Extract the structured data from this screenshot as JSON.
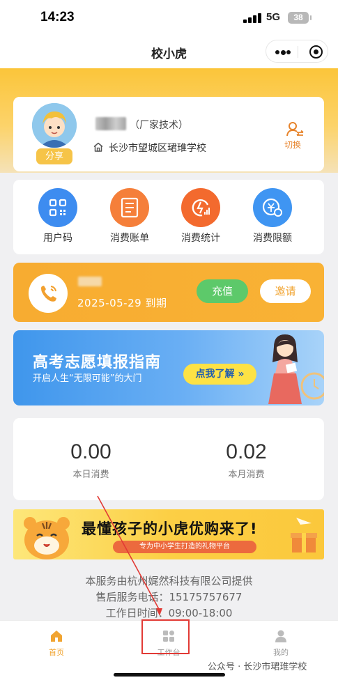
{
  "status_bar": {
    "time": "14:23",
    "network": "5G",
    "battery": "38"
  },
  "nav": {
    "title": "校小虎"
  },
  "profile": {
    "role": "（厂家技术）",
    "school": "长沙市望城区珺琟学校",
    "share_label": "分享",
    "switch_label": "切换"
  },
  "quick_actions": [
    {
      "label": "用户码",
      "icon": "qr-code-icon",
      "color": "#3d8cf0"
    },
    {
      "label": "消费账单",
      "icon": "bill-icon",
      "color": "#f57f3a"
    },
    {
      "label": "消费统计",
      "icon": "statistics-icon",
      "color": "#f36a2e"
    },
    {
      "label": "消费限额",
      "icon": "limit-icon",
      "color": "#3f95f2"
    }
  ],
  "membership": {
    "expire_text": "2025-05-29 到期",
    "recharge_label": "充值",
    "invite_label": "邀请"
  },
  "banner": {
    "title": "高考志愿填报指南",
    "subtitle": "开启人生“无限可能”的大门",
    "button": "点我了解 »"
  },
  "stats": [
    {
      "value": "0.00",
      "label": "本日消费"
    },
    {
      "value": "0.02",
      "label": "本月消费"
    }
  ],
  "shop_banner": {
    "title": "最懂孩子的小虎优购来了!",
    "subtitle": "专为中小学生打造的礼物平台"
  },
  "footer": {
    "provider": "本服务由杭州娓然科技有限公司提供",
    "phone": "售后服务电话：15175757677",
    "hours": "工作日时间：09:00-18:00"
  },
  "tabs": [
    {
      "label": "首页",
      "icon": "home-icon",
      "active": true
    },
    {
      "label": "工作台",
      "icon": "workbench-icon",
      "active": false
    },
    {
      "label": "我的",
      "icon": "user-icon",
      "active": false
    }
  ],
  "watermark": "公众号 · 长沙市珺琟学校",
  "colors": {
    "accent_orange": "#f1a431",
    "recharge_green": "#5dc96a",
    "highlight_red": "#e23a35",
    "banner_blue": "#3f96ec"
  }
}
